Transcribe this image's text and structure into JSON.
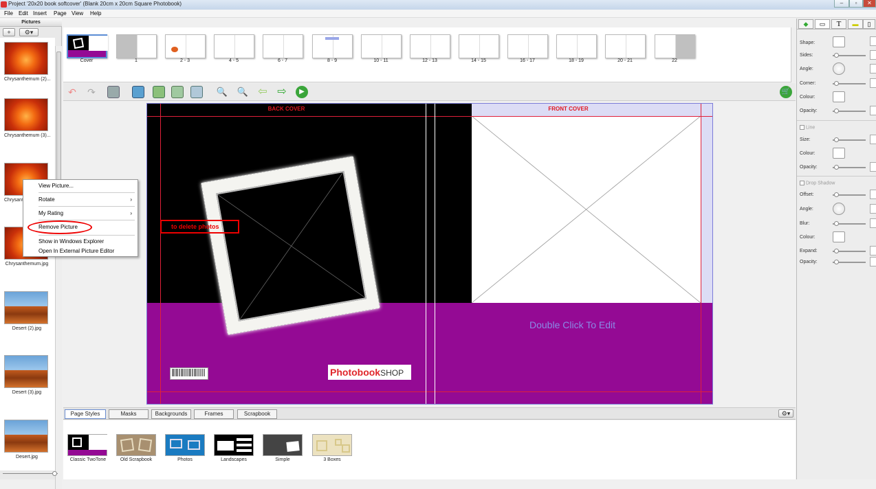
{
  "window": {
    "title": "Project '20x20 book softcover' (Blank 20cm x 20cm Square Photobook)"
  },
  "menu": [
    "File",
    "Edit",
    "Insert",
    "Page",
    "View",
    "Help"
  ],
  "left_panel": {
    "header": "Pictures",
    "add_label": "+",
    "pictures": [
      {
        "label": "Chrysanthemum (2)...",
        "kind": "flower"
      },
      {
        "label": "Chrysanthemum (3)...",
        "kind": "flower"
      },
      {
        "label": "Chrysant...",
        "kind": "flower"
      },
      {
        "label": "Chrysanthemum.jpg",
        "kind": "flower"
      },
      {
        "label": "Desert (2).jpg",
        "kind": "desert"
      },
      {
        "label": "Desert (3).jpg",
        "kind": "desert"
      },
      {
        "label": "Desert.jpg",
        "kind": "desert"
      }
    ]
  },
  "context_menu": {
    "items": [
      "View Picture...",
      "Rotate",
      "My Rating",
      "Remove Picture",
      "Show in Windows Explorer",
      "Open In External Picture Editor"
    ],
    "submenu_arrow": "›"
  },
  "pages_strip": [
    "Cover",
    "1",
    "2 - 3",
    "4 - 5",
    "6 - 7",
    "8 - 9",
    "10 - 11",
    "12 - 13",
    "14 - 15",
    "16 - 17",
    "18 - 19",
    "20 - 21",
    "22"
  ],
  "spread": {
    "back_cover_label": "BACK COVER",
    "front_cover_label": "FRONT COVER",
    "placeholder_text": "Double Click To Edit",
    "logo_main": "Photobook",
    "logo_shop": "SHOP"
  },
  "annotation": {
    "text": "to delete photos",
    "color": "#e00000"
  },
  "bottom_tabs": [
    "Page Styles",
    "Masks",
    "Backgrounds",
    "Frames",
    "Scrapbook"
  ],
  "page_styles": [
    "Classic TwoTone",
    "Old Scrapbook",
    "Photos",
    "Landscapes",
    "Simple",
    "3 Boxes"
  ],
  "right_panel": {
    "shape_props": [
      "Shape:",
      "Sides:",
      "Angle:",
      "Corner:",
      "Colour:",
      "Opacity:"
    ],
    "line_header": "Line",
    "line_props": [
      "Size:",
      "Colour:",
      "Opacity:"
    ],
    "shadow_header": "Drop Shadow",
    "shadow_props": [
      "Offset:",
      "Angle:",
      "Blur:",
      "Colour:",
      "Expand:",
      "Opacity:"
    ]
  },
  "colors": {
    "purple": "#940a94",
    "accent_red": "#e01820",
    "placeholder": "#8a8ae6"
  }
}
